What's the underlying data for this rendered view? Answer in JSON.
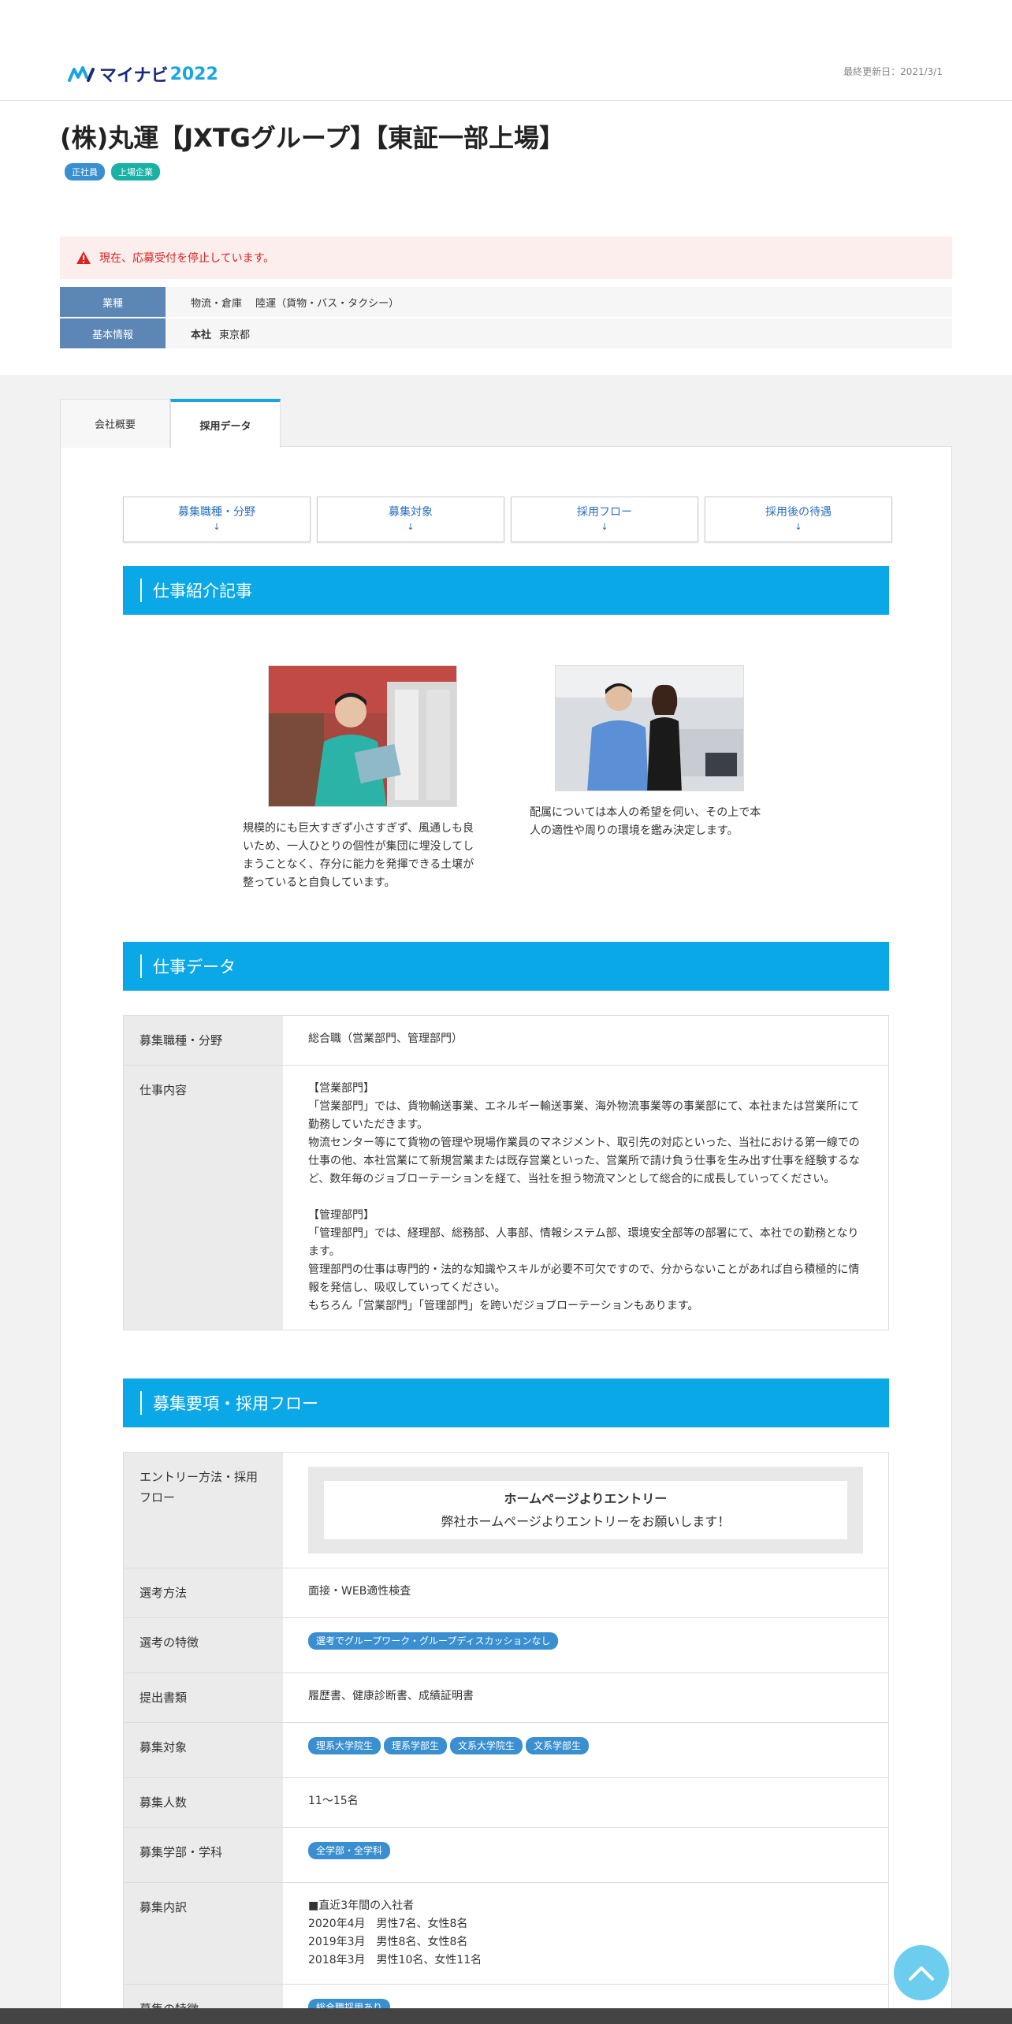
{
  "header": {
    "logo_text": "マイナビ",
    "logo_year": "2022",
    "updated": "最終更新日：2021/3/1"
  },
  "company": {
    "name": "(株)丸運【JXTGグループ】【東証一部上場】",
    "badges": [
      "正社員",
      "上場企業"
    ]
  },
  "alert": "現在、応募受付を停止しています。",
  "info": {
    "industry_label": "業種",
    "industry_value": "物流・倉庫　 陸運（貨物・バス・タクシー）",
    "basic_label": "基本情報",
    "basic_key": "本社",
    "basic_value": "東京都"
  },
  "tabs": [
    "会社概要",
    "採用データ"
  ],
  "anchors": [
    {
      "label": "募集職種・分野",
      "arrow": "↓"
    },
    {
      "label": "募集対象",
      "arrow": "↓"
    },
    {
      "label": "採用フロー",
      "arrow": "↓"
    },
    {
      "label": "採用後の待遇",
      "arrow": "↓"
    }
  ],
  "sections": {
    "articles": "仕事紹介記事",
    "job_data": "仕事データ",
    "requirements": "募集要項・採用フロー"
  },
  "articles": [
    "規模的にも巨大すぎず小さすぎず、風通しも良いため、一人ひとりの個性が集団に埋没してしまうことなく、存分に能力を発揮できる土壌が整っていると自負しています。",
    "配属については本人の希望を伺い、その上で本人の適性や周りの環境を鑑み決定します。"
  ],
  "job_data": {
    "field_label": "募集職種・分野",
    "field_value": "総合職（営業部門、管理部門）",
    "content_label": "仕事内容",
    "content_lines": [
      "【営業部門】",
      "「営業部門」では、貨物輸送事業、エネルギー輸送事業、海外物流事業等の事業部にて、本社または営業所にて勤務していただきます。",
      "物流センター等にて貨物の管理や現場作業員のマネジメント、取引先の対応といった、当社における第一線での仕事の他、本社営業にて新規営業または既存営業といった、営業所で請け負う仕事を生み出す仕事を経験するなど、数年毎のジョブローテーションを経て、当社を担う物流マンとして総合的に成長していってください。",
      "",
      "【管理部門】",
      "「管理部門」では、経理部、総務部、人事部、情報システム部、環境安全部等の部署にて、本社での勤務となります。",
      "管理部門の仕事は専門的・法的な知識やスキルが必要不可欠ですので、分からないことがあれば自ら積極的に情報を発信し、吸収していってください。",
      "もちろん「営業部門」「管理部門」を跨いだジョブローテーションもあります。"
    ]
  },
  "requirements": {
    "entry_label": "エントリー方法・採用フロー",
    "entry_title": "ホームページよりエントリー",
    "entry_sub": "弊社ホームページよりエントリーをお願いします！",
    "method_label": "選考方法",
    "method_value": "面接・WEB適性検査",
    "feature_label": "選考の特徴",
    "feature_pill": "選考でグループワーク・グループディスカッションなし",
    "docs_label": "提出書類",
    "docs_value": "履歴書、健康診断書、成績証明書",
    "target_label": "募集対象",
    "target_pills": [
      "理系大学院生",
      "理系学部生",
      "文系大学院生",
      "文系学部生"
    ],
    "count_label": "募集人数",
    "count_value": "11～15名",
    "faculty_label": "募集学部・学科",
    "faculty_pill": "全学部・全学科",
    "breakdown_label": "募集内訳",
    "breakdown_lines": [
      "■直近3年間の入社者",
      "2020年4月　男性7名、女性8名",
      "2019年3月　男性8名、女性8名",
      "2018年3月　男性10名、女性11名"
    ],
    "special_label": "募集の特徴",
    "special_pill": "総合職採用あり"
  }
}
